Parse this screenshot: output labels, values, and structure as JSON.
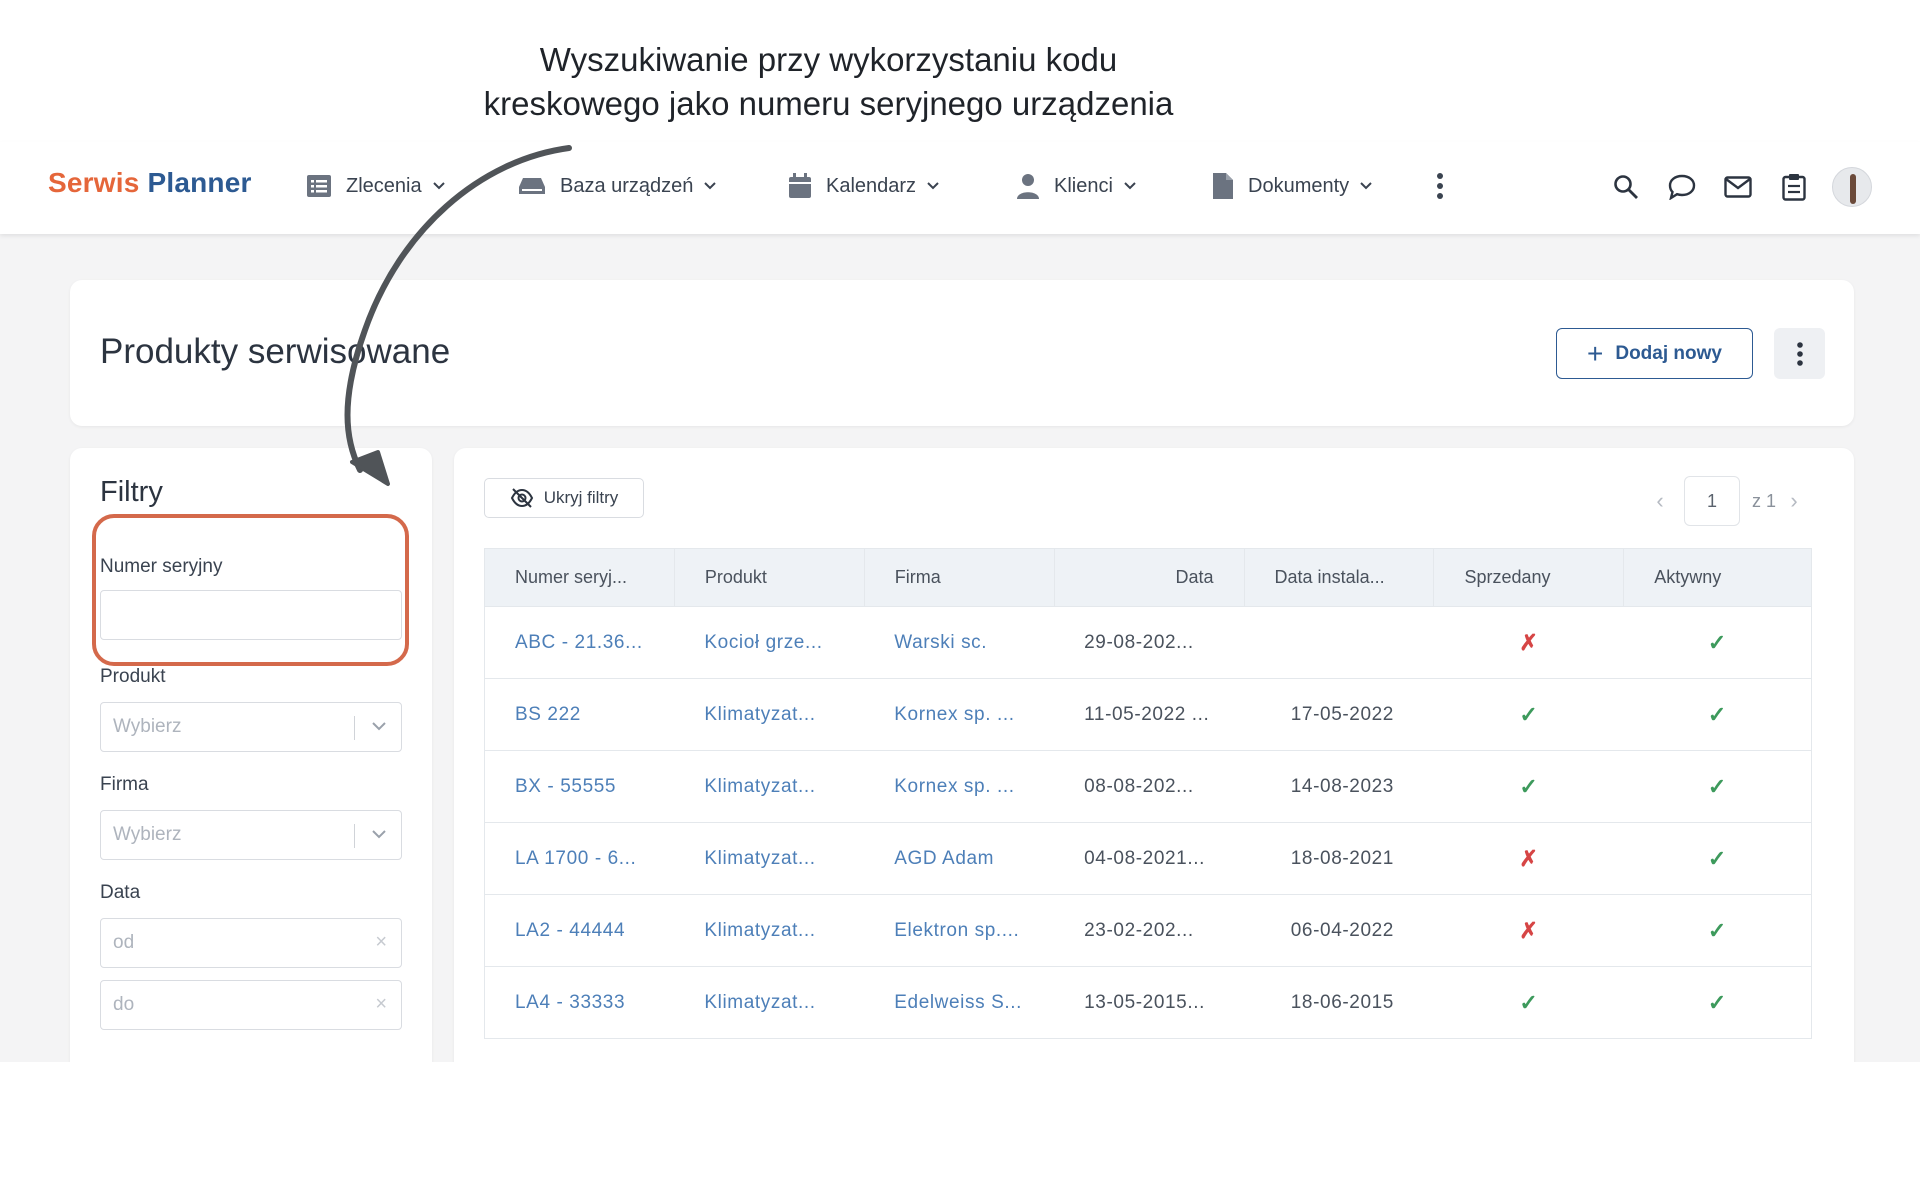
{
  "caption": {
    "line1": "Wyszukiwanie przy wykorzystaniu kodu",
    "line2": "kreskowego jako numeru seryjnego urządzenia"
  },
  "nav": {
    "logo_part1": "Serwis",
    "logo_part2": "Planner",
    "items": [
      {
        "label": "Zlecenia",
        "icon": "list-icon"
      },
      {
        "label": "Baza urządzeń",
        "icon": "device-icon"
      },
      {
        "label": "Kalendarz",
        "icon": "calendar-icon"
      },
      {
        "label": "Klienci",
        "icon": "user-icon"
      },
      {
        "label": "Dokumenty",
        "icon": "document-icon"
      }
    ],
    "tools": [
      "search-icon",
      "chat-icon",
      "mail-icon",
      "clipboard-icon",
      "avatar"
    ]
  },
  "header": {
    "title": "Produkty serwisowane",
    "add_label": "Dodaj nowy"
  },
  "filters": {
    "title": "Filtry",
    "serial_label": "Numer seryjny",
    "serial_value": "",
    "product_label": "Produkt",
    "product_placeholder": "Wybierz",
    "company_label": "Firma",
    "company_placeholder": "Wybierz",
    "date_label": "Data",
    "date_from_placeholder": "od",
    "date_to_placeholder": "do"
  },
  "table": {
    "hide_filters_label": "Ukryj filtry",
    "pagination": {
      "current": "1",
      "of": "z 1"
    },
    "columns": [
      "Numer seryj...",
      "Produkt",
      "Firma",
      "Data",
      "Data instala...",
      "Sprzedany",
      "Aktywny"
    ],
    "rows": [
      {
        "serial": "ABC - 21.36...",
        "product": "Kocioł grze...",
        "company": "Warski sc.",
        "date": "29-08-202...",
        "install": "",
        "sold": false,
        "active": true
      },
      {
        "serial": "BS 222",
        "product": "Klimatyzat...",
        "company": "Kornex sp. ...",
        "date": "11-05-2022 ...",
        "install": "17-05-2022",
        "sold": true,
        "active": true
      },
      {
        "serial": "BX - 55555",
        "product": "Klimatyzat...",
        "company": "Kornex sp. ...",
        "date": "08-08-202...",
        "install": "14-08-2023",
        "sold": true,
        "active": true
      },
      {
        "serial": "LA 1700 - 6...",
        "product": "Klimatyzat...",
        "company": "AGD Adam",
        "date": "04-08-2021...",
        "install": "18-08-2021",
        "sold": false,
        "active": true
      },
      {
        "serial": "LA2 - 44444",
        "product": "Klimatyzat...",
        "company": "Elektron sp....",
        "date": "23-02-202...",
        "install": "06-04-2022",
        "sold": false,
        "active": true
      },
      {
        "serial": "LA4 - 33333",
        "product": "Klimatyzat...",
        "company": "Edelweiss S...",
        "date": "13-05-2015...",
        "install": "18-06-2015",
        "sold": true,
        "active": true
      }
    ]
  },
  "colors": {
    "brand_orange": "#e5663a",
    "brand_blue": "#2d5a92",
    "highlight": "#d4694b",
    "check_green": "#3d9a5c",
    "cross_red": "#d64545"
  }
}
